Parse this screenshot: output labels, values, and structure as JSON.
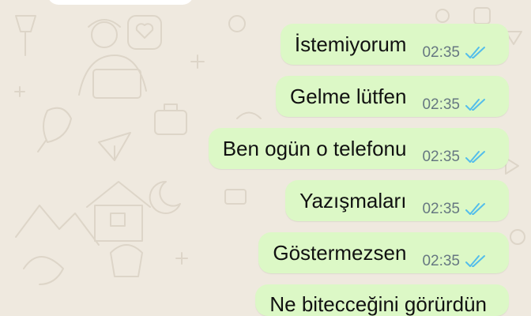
{
  "colors": {
    "wallpaper": "#efe9df",
    "outgoing_bubble": "#dcf8c6",
    "incoming_bubble": "#ffffff",
    "read_ticks": "#53bdeb",
    "timestamp": "#667781"
  },
  "messages": [
    {
      "text": "İstemiyorum",
      "time": "02:35",
      "status": "read",
      "status_icon": "double-check-icon"
    },
    {
      "text": "Gelme lütfen",
      "time": "02:35",
      "status": "read",
      "status_icon": "double-check-icon"
    },
    {
      "text": "Ben ogün o telefonu",
      "time": "02:35",
      "status": "read",
      "status_icon": "double-check-icon"
    },
    {
      "text": "Yazışmaları",
      "time": "02:35",
      "status": "read",
      "status_icon": "double-check-icon"
    },
    {
      "text": "Göstermezsen",
      "time": "02:35",
      "status": "read",
      "status_icon": "double-check-icon"
    },
    {
      "text": "Ne bitecceğini görürdün",
      "time": "",
      "status": "",
      "status_icon": ""
    }
  ]
}
